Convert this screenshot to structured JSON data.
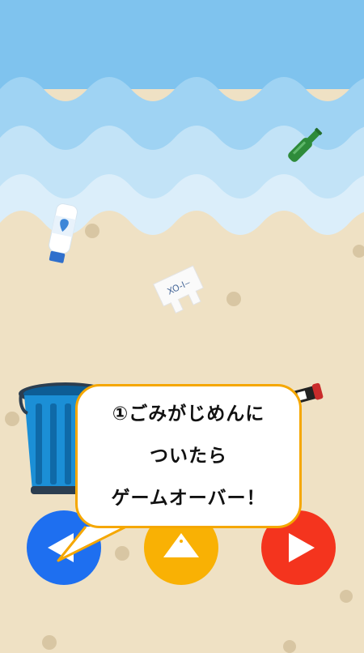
{
  "tutorial": {
    "lines": [
      "①ごみがじめんに",
      "ついたら",
      "ゲームオーバー！"
    ]
  },
  "scene": {
    "sky_color": "#7fc3ee",
    "sand_color": "#efe1c4",
    "wave_colors": [
      "#9fd3f3",
      "#c2e3f7",
      "#dbeefa"
    ]
  },
  "trash": [
    {
      "name": "green-bottle-icon",
      "color": "#2e8b3a"
    },
    {
      "name": "water-bottle-icon",
      "color": "#2f6fcc"
    },
    {
      "name": "plastic-bag-icon",
      "color": "#ffffff"
    },
    {
      "name": "can-icon",
      "color": "#c92b2b"
    }
  ],
  "trash_can": {
    "color": "#1b8fd6"
  },
  "controls": {
    "left": {
      "icon": "left-arrow-icon",
      "color": "#1e6ff0"
    },
    "jump": {
      "icon": "up-triangle-icon",
      "color": "#f9b104"
    },
    "right": {
      "icon": "right-arrow-icon",
      "color": "#f4341e"
    }
  }
}
